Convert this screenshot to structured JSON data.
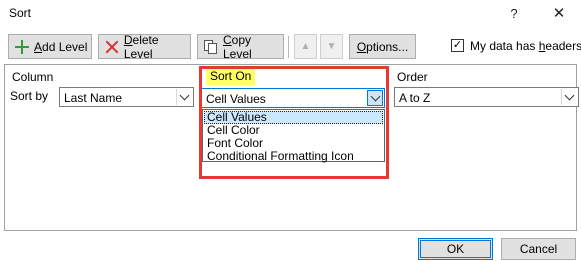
{
  "window": {
    "title": "Sort",
    "help_label": "?",
    "close_label": "✕"
  },
  "toolbar": {
    "add_level": {
      "accel": "A",
      "rest": "dd Level"
    },
    "delete_level": {
      "accel": "D",
      "rest": "elete Level"
    },
    "copy_level": {
      "accel": "C",
      "rest": "opy Level"
    },
    "move_up_label": "▲",
    "move_down_label": "▼",
    "options": {
      "accel": "O",
      "rest": "ptions..."
    },
    "headers_checkbox": {
      "checked": true,
      "mark": "✓",
      "before": "My data has ",
      "accel": "h",
      "after": "eaders"
    }
  },
  "columns": {
    "column": "Column",
    "sort_on": "Sort On",
    "order": "Order"
  },
  "row": {
    "label": "Sort by",
    "column_value": "Last Name",
    "sort_on_value": "Cell Values",
    "order_value": "A to Z"
  },
  "sort_on_options": [
    "Cell Values",
    "Cell Color",
    "Font Color",
    "Conditional Formatting Icon"
  ],
  "sort_on_selected_index": 0,
  "buttons": {
    "ok": "OK",
    "cancel": "Cancel"
  },
  "icons": {
    "add": "plus-icon",
    "delete": "x-icon",
    "copy": "copy-icon",
    "dropdown": "chevron-down-icon",
    "check": "checkmark-icon"
  },
  "colors": {
    "highlight_box": "#e53935",
    "header_highlight": "#ffff66",
    "selection": "#cce8ff",
    "accent": "#0078d7"
  }
}
